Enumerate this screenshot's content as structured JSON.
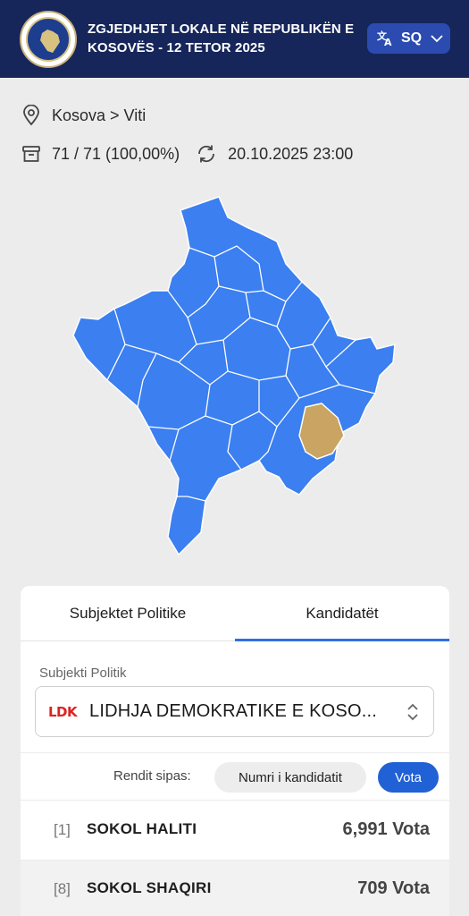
{
  "header": {
    "title_line1": "ZGJEDHJET LOKALE NË REPUBLIKËN E",
    "title_line2": "KOSOVËS - 12 TETOR 2025",
    "lang_label": "SQ"
  },
  "location": {
    "breadcrumb": "Kosova > Viti"
  },
  "stats": {
    "stations": "71 / 71 (100,00%)",
    "updated": "20.10.2025 23:00"
  },
  "colors": {
    "header_bg": "#16265a",
    "map_default": "#3b7ff0",
    "map_selected": "#c9a462",
    "accent": "#2061d6"
  },
  "tabs": [
    {
      "label": "Subjektet Politike",
      "active": false
    },
    {
      "label": "Kandidatët",
      "active": true
    }
  ],
  "filter": {
    "label": "Subjekti Politik",
    "party_logo": "LDK",
    "selected": "LIDHJA DEMOKRATIKE E KOSO..."
  },
  "sort": {
    "label": "Rendit sipas:",
    "option1": "Numri i kandidatit",
    "option2": "Vota",
    "active": "Vota"
  },
  "candidates": [
    {
      "number": "[1]",
      "name": "SOKOL HALITI",
      "votes": "6,991 Vota"
    },
    {
      "number": "[8]",
      "name": "SOKOL SHAQIRI",
      "votes": "709 Vota"
    }
  ]
}
